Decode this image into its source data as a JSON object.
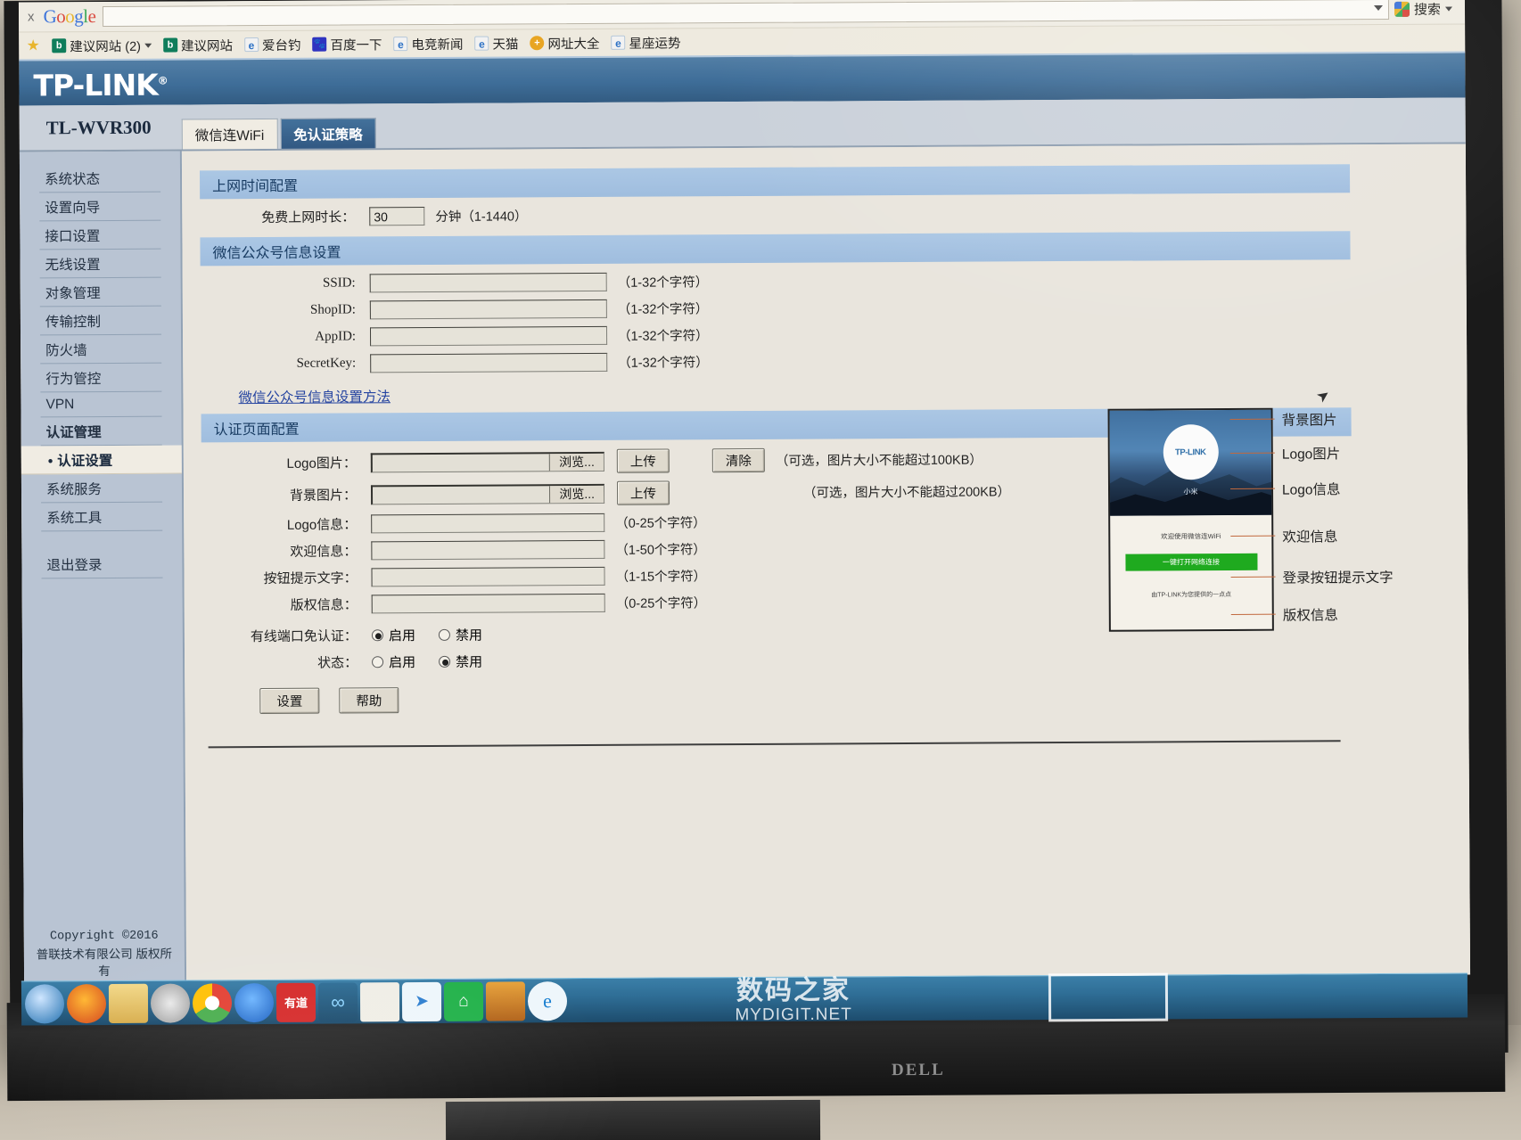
{
  "browser": {
    "close_label": "x",
    "brand": "Google",
    "omnibox_value": "",
    "search_label": "搜索",
    "bookmarks": [
      {
        "icon": "star-icon",
        "label": ""
      },
      {
        "icon": "bing-icon",
        "label": "建议网站 (2)"
      },
      {
        "icon": "bing-icon",
        "label": "建议网站"
      },
      {
        "icon": "ie-icon",
        "label": "爱台钓"
      },
      {
        "icon": "baidu-icon",
        "label": "百度一下"
      },
      {
        "icon": "ie-icon",
        "label": "电竞新闻"
      },
      {
        "icon": "ie-icon",
        "label": "天猫"
      },
      {
        "icon": "plus-icon",
        "label": "网址大全"
      },
      {
        "icon": "ie-icon",
        "label": "星座运势"
      }
    ]
  },
  "header": {
    "brand": "TP-LINK",
    "brand_mark": "®",
    "model": "TL-WVR300"
  },
  "tabs": [
    {
      "label": "微信连WiFi",
      "active": true
    },
    {
      "label": "免认证策略",
      "active": false
    }
  ],
  "sidebar": {
    "items": [
      {
        "label": "系统状态",
        "type": "item"
      },
      {
        "label": "设置向导",
        "type": "item"
      },
      {
        "label": "接口设置",
        "type": "item"
      },
      {
        "label": "无线设置",
        "type": "item"
      },
      {
        "label": "对象管理",
        "type": "item"
      },
      {
        "label": "传输控制",
        "type": "item"
      },
      {
        "label": "防火墙",
        "type": "item"
      },
      {
        "label": "行为管控",
        "type": "item"
      },
      {
        "label": "VPN",
        "type": "item"
      },
      {
        "label": "认证管理",
        "type": "group"
      },
      {
        "label": "认证设置",
        "type": "sub-active"
      },
      {
        "label": "系统服务",
        "type": "item"
      },
      {
        "label": "系统工具",
        "type": "item"
      }
    ],
    "logout": "退出登录",
    "copyright_line1": "Copyright ©2016",
    "copyright_line2": "普联技术有限公司 版权所",
    "copyright_line3": "有"
  },
  "time_section": {
    "title": "上网时间配置",
    "duration_label": "免费上网时长：",
    "duration_value": "30",
    "duration_unit_hint": "分钟（1-1440）"
  },
  "wechat_section": {
    "title": "微信公众号信息设置",
    "fields": [
      {
        "label": "SSID:",
        "value": "",
        "hint": "（1-32个字符）"
      },
      {
        "label": "ShopID:",
        "value": "",
        "hint": "（1-32个字符）"
      },
      {
        "label": "AppID:",
        "value": "",
        "hint": "（1-32个字符）"
      },
      {
        "label": "SecretKey:",
        "value": "",
        "hint": "（1-32个字符）"
      }
    ],
    "help_link": "微信公众号信息设置方法"
  },
  "auth_section": {
    "title": "认证页面配置",
    "logo_image_label": "Logo图片：",
    "bg_image_label": "背景图片：",
    "browse_label": "浏览...",
    "upload_label": "上传",
    "clear_label": "清除",
    "logo_size_hint": "（可选，图片大小不能超过100KB）",
    "bg_size_hint": "（可选，图片大小不能超过200KB）",
    "logo_file_value": "",
    "bg_file_value": "",
    "text_fields": [
      {
        "label": "Logo信息：",
        "value": "",
        "hint": "（0-25个字符）"
      },
      {
        "label": "欢迎信息：",
        "value": "",
        "hint": "（1-50个字符）"
      },
      {
        "label": "按钮提示文字：",
        "value": "",
        "hint": "（1-15个字符）"
      },
      {
        "label": "版权信息：",
        "value": "",
        "hint": "（0-25个字符）"
      }
    ],
    "wired_free_label": "有线端口免认证：",
    "wired_enable": "启用",
    "wired_disable": "禁用",
    "wired_selected": "启用",
    "status_label": "状态：",
    "status_enable": "启用",
    "status_disable": "禁用",
    "status_selected": "禁用",
    "submit_label": "设置",
    "help_label": "帮助"
  },
  "preview": {
    "logo_text": "TP-LINK",
    "logo_info": "小米",
    "welcome": "欢迎使用微信连WiFi",
    "button_text": "一键打开网络连接",
    "copyright": "由TP-LINK为您提供的一点点",
    "annotations": [
      "背景图片",
      "Logo图片",
      "Logo信息",
      "欢迎信息",
      "登录按钮提示文字",
      "版权信息"
    ]
  },
  "taskbar": {
    "items": [
      "start-icon",
      "firefox-icon",
      "explorer-icon",
      "snip-icon",
      "chrome-icon",
      "blue-drop-icon",
      "youdao-icon",
      "flower-icon",
      "document-icon",
      "bird-icon",
      "house-icon",
      "media-icon",
      "ie-icon"
    ]
  },
  "watermark": {
    "cn": "数码之家",
    "en": "MYDIGIT.NET"
  },
  "desktop": {
    "monitor_brand": "DELL"
  }
}
